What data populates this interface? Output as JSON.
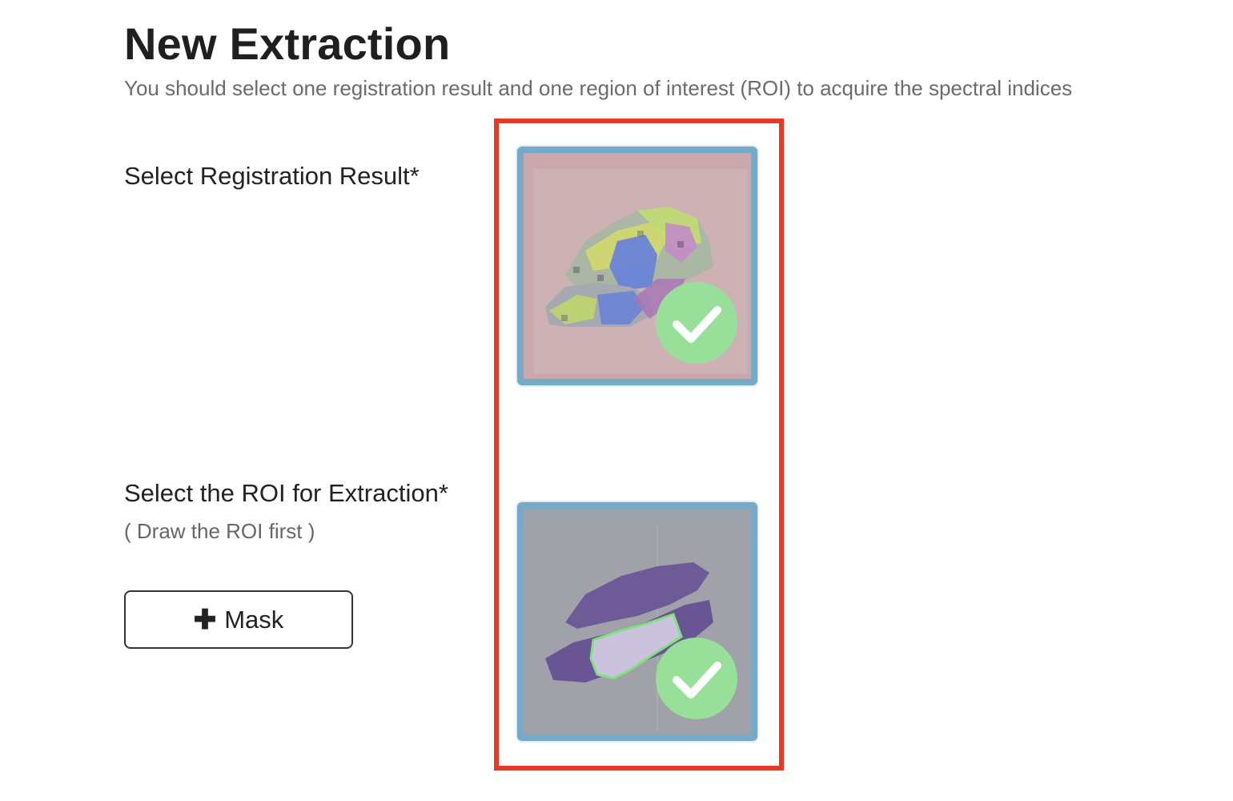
{
  "page": {
    "title": "New Extraction",
    "subtitle": "You should select one registration result and one region of interest (ROI) to acquire the spectral indices"
  },
  "registration": {
    "label": "Select Registration Result*",
    "selected": true
  },
  "roi": {
    "label": "Select the ROI for Extraction*",
    "hint": "( Draw the ROI first )",
    "selected": true
  },
  "mask_button": {
    "icon": "plus-icon",
    "label": "Mask"
  },
  "colors": {
    "highlight": "#e63a25",
    "card_border": "#76aac9",
    "check_badge": "#98e09a"
  }
}
